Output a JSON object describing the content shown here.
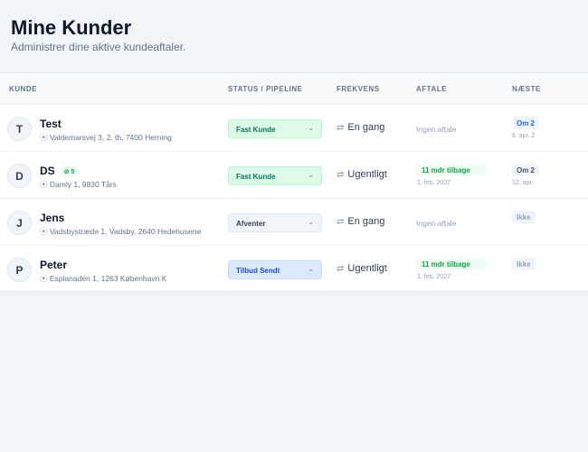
{
  "header": {
    "title": "Mine Kunder",
    "subtitle": "Administrer dine aktive kundeaftaler."
  },
  "columns": [
    "KUNDE",
    "STATUS / PIPELINE",
    "FREKVENS",
    "AFTALE",
    "NÆSTE"
  ],
  "customers": [
    {
      "initial": "T",
      "name": "Test",
      "badge": "",
      "address": "Valdemarsvej 3, 2. th, 7400 Herning",
      "status": "Fast Kunde",
      "status_color": "#dcfce7",
      "frequency": "En gang",
      "deal": "Ingen aftale",
      "deal_date": "",
      "next": "Om 2",
      "next_date": "6. apr. 2"
    },
    {
      "initial": "D",
      "name": "DS",
      "badge": "5",
      "address": "Damly 1, 9830 Tårs",
      "status": "Fast Kunde",
      "status_color": "#dcfce7",
      "frequency": "Ugentligt",
      "deal": "11 mdr tilbage",
      "deal_date": "1. feb. 2027",
      "next": "Om 2",
      "next_date": "12. apr."
    },
    {
      "initial": "J",
      "name": "Jens",
      "badge": "",
      "address": "Vadsbystræde 1, Vadsby, 2640 Hedehusene",
      "status": "Afventer",
      "status_color": "#f1f5f9",
      "frequency": "En gang",
      "deal": "Ingen aftale",
      "deal_date": "",
      "next": "Ikke",
      "next_date": ""
    },
    {
      "initial": "P",
      "name": "Peter",
      "badge": "",
      "address": "Esplanaden 1, 1263 København K",
      "status": "Tilbud Sendt",
      "status_color": "#dbeafe",
      "frequency": "Ugentligt",
      "deal": "11 mdr tilbage",
      "deal_date": "1. feb. 2027",
      "next": "Ikke",
      "next_date": ""
    }
  ]
}
